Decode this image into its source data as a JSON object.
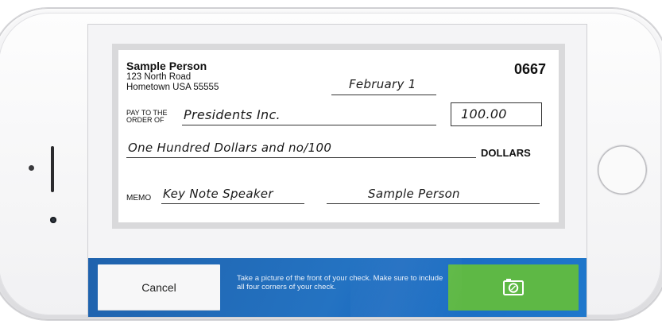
{
  "check": {
    "payer_name": "Sample Person",
    "payer_address_line1": "123 North Road",
    "payer_address_line2": "Hometown USA 55555",
    "number": "0667",
    "date": "February 1",
    "pay_to_label_1": "PAY TO THE",
    "pay_to_label_2": "ORDER OF",
    "payee": "Presidents Inc.",
    "amount": "100.00",
    "amount_words": "One Hundred Dollars and no/100",
    "dollars_label": "DOLLARS",
    "memo_label": "MEMO",
    "memo": "Key Note Speaker",
    "signature": "Sample Person"
  },
  "action_bar": {
    "cancel_label": "Cancel",
    "instruction": "Take a picture of the front of your check. Make sure to include all four corners of your check.",
    "capture_icon": "camera-icon"
  },
  "colors": {
    "action_bar_blue": "#2473c2",
    "capture_green": "#5eb845"
  }
}
